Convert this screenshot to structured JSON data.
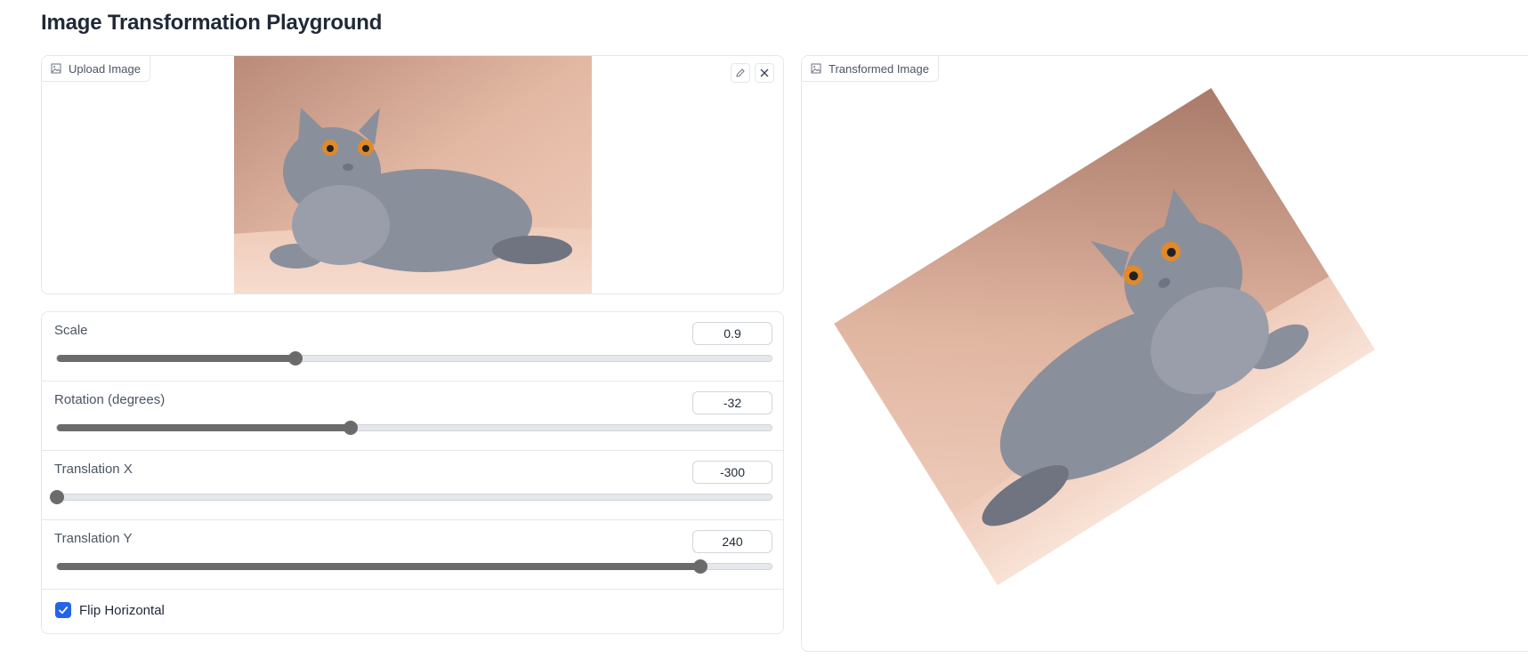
{
  "page": {
    "title": "Image Transformation Playground"
  },
  "upload": {
    "label": "Upload Image",
    "icon": "image-icon",
    "edit_icon": "pencil-icon",
    "clear_icon": "close-icon"
  },
  "result": {
    "label": "Transformed Image",
    "icon": "image-icon"
  },
  "sliders": [
    {
      "label": "Scale",
      "value": "0.9",
      "min": 0.1,
      "max": 2.5,
      "numeric": 0.9
    },
    {
      "label": "Rotation (degrees)",
      "value": "-32",
      "min": -180,
      "max": 180,
      "numeric": -32
    },
    {
      "label": "Translation X",
      "value": "-300",
      "min": -300,
      "max": 300,
      "numeric": -300
    },
    {
      "label": "Translation Y",
      "value": "240",
      "min": -300,
      "max": 300,
      "numeric": 240
    }
  ],
  "flip": {
    "label": "Flip Horizontal",
    "checked": true
  },
  "colors": {
    "accent": "#2563eb",
    "slider": "#6b6b6b",
    "cat_body": "#8a8f9c",
    "backdrop": "#e9c3b2",
    "eyes": "#e08a2c"
  }
}
